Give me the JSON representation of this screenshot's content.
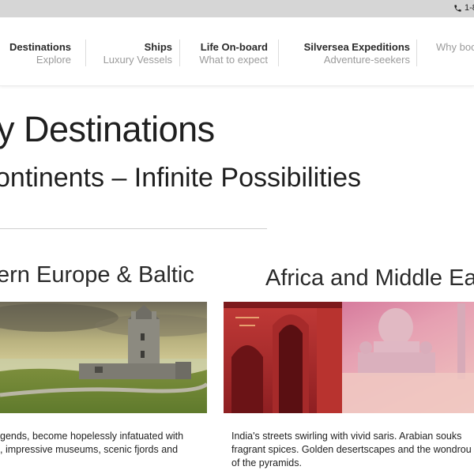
{
  "topbar": {
    "phone_text": "1-8"
  },
  "nav": {
    "items": [
      {
        "title": "Destinations",
        "subtitle": "Explore"
      },
      {
        "title": "Ships",
        "subtitle": "Luxury Vessels"
      },
      {
        "title": "Life On-board",
        "subtitle": "What to expect"
      },
      {
        "title": "Silversea Expeditions",
        "subtitle": "Adventure-seekers"
      },
      {
        "title": "",
        "subtitle": "Why boo"
      }
    ]
  },
  "hero": {
    "title": "y Destinations",
    "subtitle": "ontinents – Infinite Possibilities"
  },
  "cards": [
    {
      "title": "ern Europe & Baltic",
      "desc_lines": [
        "gends, become hopelessly infatuated with",
        ", impressive museums, scenic fjords and"
      ]
    },
    {
      "title": "Africa and Middle East",
      "desc_lines": [
        "India's streets swirling with vivid saris. Arabian souks",
        "fragrant spices. Golden desertscapes and the wondrou",
        "of the pyramids."
      ]
    }
  ],
  "icons": {
    "phone": "phone-icon"
  }
}
